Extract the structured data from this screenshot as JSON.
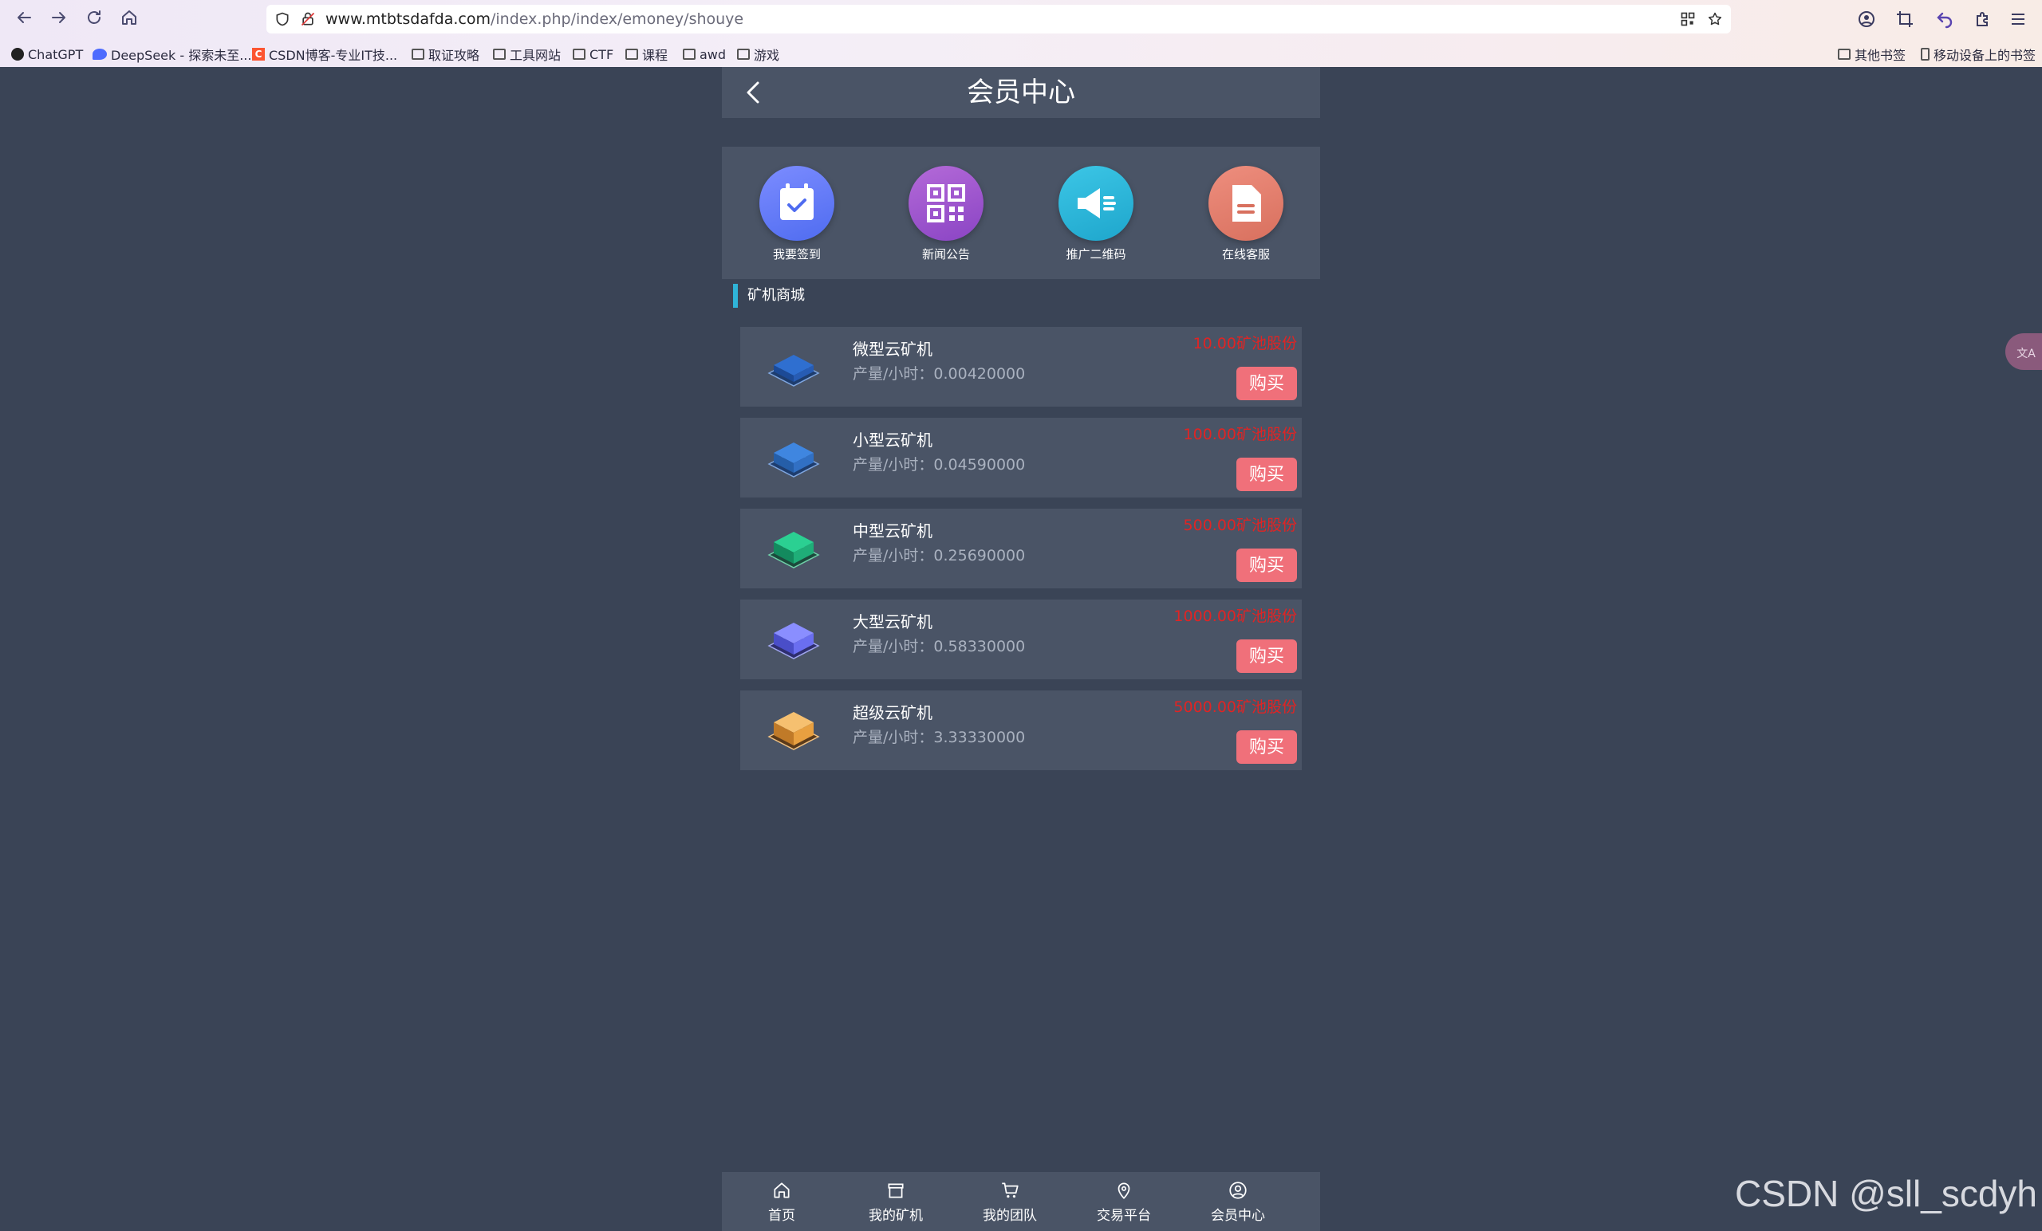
{
  "browser": {
    "url_host": "www.mtbtsdafda.com",
    "url_path": "/index.php/index/emoney/shouye",
    "bookmarks": [
      {
        "label": "ChatGPT",
        "icon": "chatgpt-icon"
      },
      {
        "label": "DeepSeek - 探索未至...",
        "icon": "deepseek-icon"
      },
      {
        "label": "CSDN博客-专业IT技...",
        "icon": "csdn-icon"
      },
      {
        "label": "取证攻略",
        "icon": "folder-icon"
      },
      {
        "label": "工具网站",
        "icon": "folder-icon"
      },
      {
        "label": "CTF",
        "icon": "folder-icon"
      },
      {
        "label": "课程",
        "icon": "folder-icon"
      },
      {
        "label": "awd",
        "icon": "folder-icon"
      },
      {
        "label": "游戏",
        "icon": "folder-icon"
      }
    ],
    "other_bookmarks": "其他书签",
    "mobile_bookmarks": "移动设备上的书签"
  },
  "page": {
    "title": "会员中心",
    "quick_links": [
      {
        "label": "我要签到",
        "icon": "calendar-check-icon",
        "color_from": "#7c8cff",
        "color_to": "#4f6cf0"
      },
      {
        "label": "新闻公告",
        "icon": "qrcode-icon",
        "color_from": "#b46ad8",
        "color_to": "#8a44c4"
      },
      {
        "label": "推广二维码",
        "icon": "megaphone-icon",
        "color_from": "#3cc6e6",
        "color_to": "#1ea6cc"
      },
      {
        "label": "在线客服",
        "icon": "document-icon",
        "color_from": "#ee8e7e",
        "color_to": "#d8705e"
      }
    ],
    "section_title": "矿机商城",
    "miners": [
      {
        "name": "微型云矿机",
        "rate": "产量/小时：0.00420000",
        "price": "10.00矿池股份",
        "buy": "购买",
        "color": "#2f6fd0"
      },
      {
        "name": "小型云矿机",
        "rate": "产量/小时：0.04590000",
        "price": "100.00矿池股份",
        "buy": "购买",
        "color": "#3f86e0"
      },
      {
        "name": "中型云矿机",
        "rate": "产量/小时：0.25690000",
        "price": "500.00矿池股份",
        "buy": "购买",
        "color": "#1fae78"
      },
      {
        "name": "大型云矿机",
        "rate": "产量/小时：0.58330000",
        "price": "1000.00矿池股份",
        "buy": "购买",
        "color": "#6a6ef0"
      },
      {
        "name": "超级云矿机",
        "rate": "产量/小时：3.33330000",
        "price": "5000.00矿池股份",
        "buy": "购买",
        "color": "#e8a040"
      }
    ],
    "tabs": [
      {
        "label": "首页",
        "icon": "home-icon"
      },
      {
        "label": "我的矿机",
        "icon": "store-icon"
      },
      {
        "label": "我的团队",
        "icon": "cart-icon"
      },
      {
        "label": "交易平台",
        "icon": "location-pin-icon"
      },
      {
        "label": "会员中心",
        "icon": "user-circle-icon"
      }
    ]
  },
  "watermark": "CSDN @sll_scdyh",
  "colors": {
    "accent": "#2fb4d8",
    "buy_button": "#f0707a",
    "price": "#e02424",
    "panel": "#4a5466",
    "background": "#3a4456"
  }
}
